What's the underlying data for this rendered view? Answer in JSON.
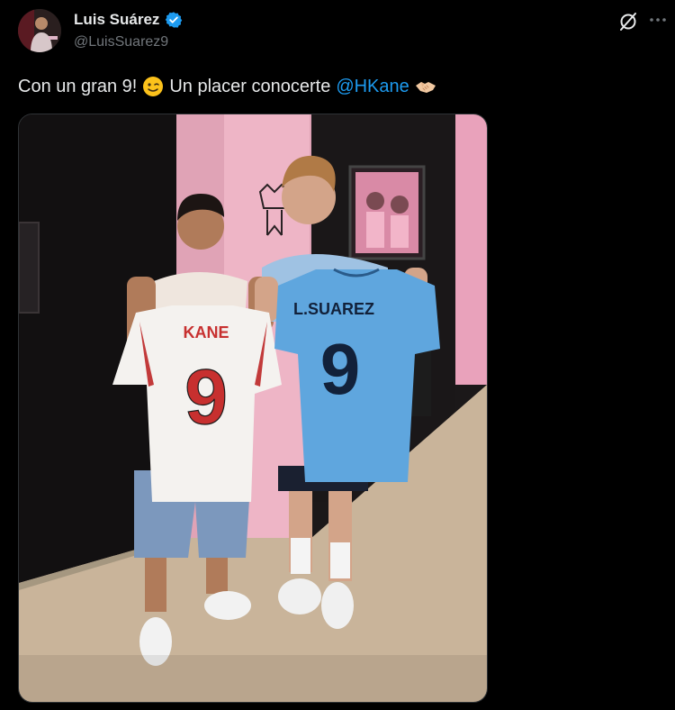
{
  "author": {
    "display_name": "Luis Suárez",
    "handle": "@LuisSuarez9"
  },
  "tweet": {
    "text_part1": "Con un gran 9!",
    "text_part2": "Un placer conocerte",
    "mention": "@HKane",
    "emoji_1": "winking-face",
    "emoji_2": "handshake"
  },
  "media": {
    "shirt_left_name": "KANE",
    "shirt_left_number": "9",
    "shirt_right_name": "L.SUAREZ",
    "shirt_right_number": "9"
  },
  "colors": {
    "background": "#000000",
    "text": "#e7e9ea",
    "secondary": "#71767b",
    "link": "#1d9bf0",
    "verified": "#1d9bf0"
  }
}
